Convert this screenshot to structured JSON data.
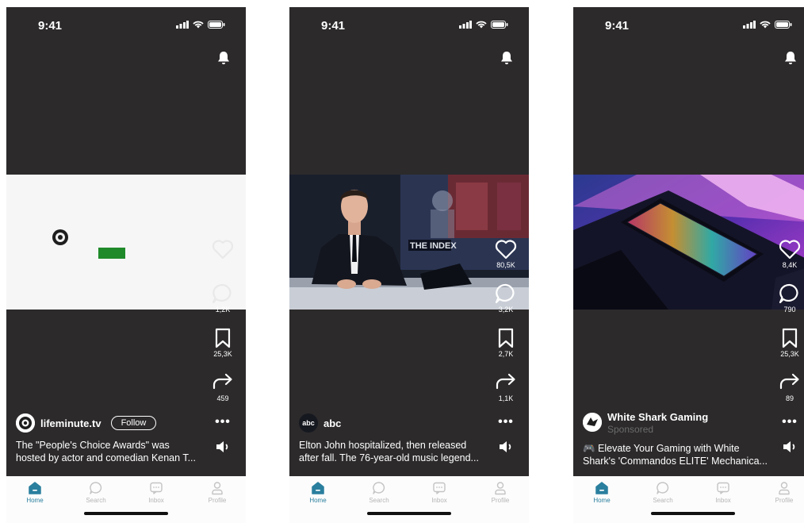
{
  "status_bar": {
    "time": "9:41"
  },
  "nav": {
    "items": [
      {
        "label": "Home",
        "icon": "home-icon",
        "active": true
      },
      {
        "label": "Search",
        "icon": "search-icon",
        "active": false
      },
      {
        "label": "Inbox",
        "icon": "inbox-icon",
        "active": false
      },
      {
        "label": "Profile",
        "icon": "profile-icon",
        "active": false
      }
    ]
  },
  "colors": {
    "background": "#2c2a2b",
    "accent": "#2a7f9e",
    "sponsor_gray": "#6b6b6b"
  },
  "screens": [
    {
      "author": "lifeminute.tv",
      "follow_label": "Follow",
      "caption_line1": "The \"People's Choice Awards\" was",
      "caption_line2": "hosted by actor and comedian Kenan T...",
      "likes": "",
      "comments": "1,2K",
      "saves": "25,3K",
      "shares": "459"
    },
    {
      "author": "abc",
      "avatar_text": "abc",
      "caption_line1": "Elton John hospitalized, then released",
      "caption_line2": "after fall. The 76-year-old music legend...",
      "likes": "80,5K",
      "comments": "3,2K",
      "saves": "2,7K",
      "shares": "1,1K",
      "tv_text": "THE INDEX"
    },
    {
      "author": "White Shark Gaming",
      "sponsored": "Sponsored",
      "caption_line1": "🎮 Elevate Your Gaming with White",
      "caption_line2": "Shark's 'Commandos ELITE' Mechanica...",
      "likes": "8,4K",
      "comments": "790",
      "saves": "25,3K",
      "shares": "89"
    }
  ]
}
